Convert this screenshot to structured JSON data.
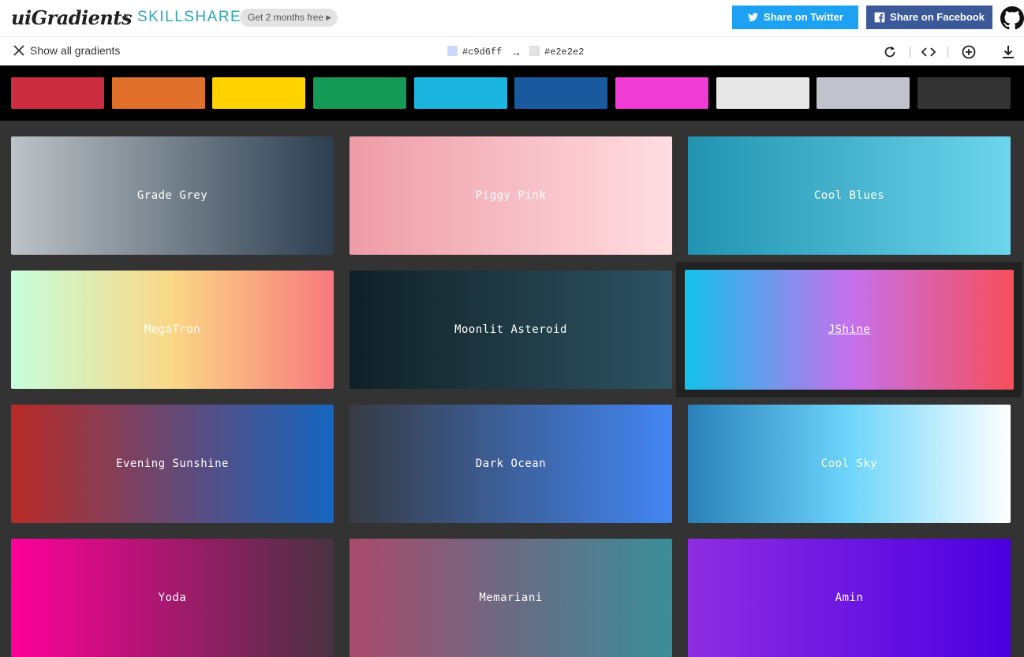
{
  "header": {
    "logo": "uiGradients",
    "plus": "+",
    "partner": "SKILLSHARE",
    "promo": "Get 2 months free",
    "twitter_label": "Share on Twitter",
    "facebook_label": "Share on Facebook"
  },
  "toolbar": {
    "show_all": "Show all gradients",
    "color_from": "#c9d6ff",
    "color_to": "#e2e2e2",
    "arrow": "→"
  },
  "palette": [
    "#cb2d3e",
    "#e0702a",
    "#ffd200",
    "#159957",
    "#1cb5e0",
    "#185a9d",
    "#f03cd4",
    "#e8e8e8",
    "#c2c2cc",
    "#333333"
  ],
  "gradients": [
    {
      "name": "Grade Grey",
      "colors": [
        "#bdc3c7",
        "#2c3e50"
      ]
    },
    {
      "name": "Piggy Pink",
      "colors": [
        "#ee9ca7",
        "#ffdde1"
      ]
    },
    {
      "name": "Cool Blues",
      "colors": [
        "#2193b0",
        "#6dd5ed"
      ]
    },
    {
      "name": "MegaTron",
      "colors": [
        "#c6ffdd",
        "#fbd786",
        "#f7797d"
      ]
    },
    {
      "name": "Moonlit Asteroid",
      "colors": [
        "#0f2027",
        "#203a43",
        "#2c5364"
      ]
    },
    {
      "name": "JShine",
      "colors": [
        "#12c2e9",
        "#c471ed",
        "#f64f59"
      ]
    },
    {
      "name": "Evening Sunshine",
      "colors": [
        "#b92b27",
        "#1565c0"
      ]
    },
    {
      "name": "Dark Ocean",
      "colors": [
        "#373b44",
        "#4286f4"
      ]
    },
    {
      "name": "Cool Sky",
      "colors": [
        "#2980b9",
        "#6dd5fa",
        "#ffffff"
      ]
    },
    {
      "name": "Yoda",
      "colors": [
        "#ff0099",
        "#493240"
      ]
    },
    {
      "name": "Memariani",
      "colors": [
        "#aa4b6b",
        "#6b6b83",
        "#3b8d99"
      ]
    },
    {
      "name": "Amin",
      "colors": [
        "#8e2de2",
        "#4a00e0"
      ]
    }
  ]
}
